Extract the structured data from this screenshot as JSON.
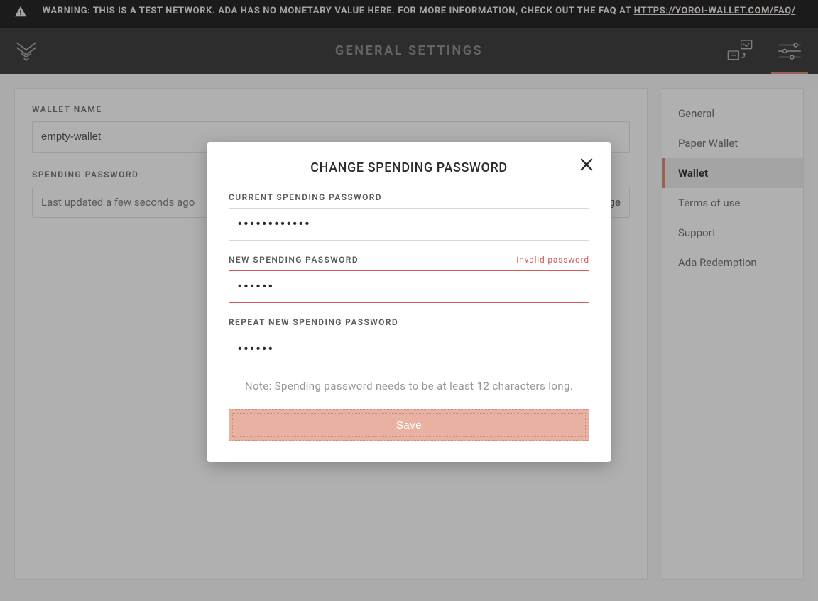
{
  "banner": {
    "text_prefix": "WARNING: THIS IS A TEST NETWORK. ADA HAS NO MONETARY VALUE HERE. FOR MORE INFORMATION, CHECK OUT THE FAQ AT ",
    "link_text": "HTTPS://YOROI-WALLET.COM/FAQ/"
  },
  "header": {
    "title": "GENERAL SETTINGS"
  },
  "settings": {
    "wallet_name_label": "WALLET NAME",
    "wallet_name_value": "empty-wallet",
    "spending_password_label": "SPENDING PASSWORD",
    "spending_password_status": "Last updated a few seconds ago",
    "spending_password_action": "change"
  },
  "sidebar": {
    "items": [
      {
        "label": "General",
        "active": false
      },
      {
        "label": "Paper Wallet",
        "active": false
      },
      {
        "label": "Wallet",
        "active": true
      },
      {
        "label": "Terms of use",
        "active": false
      },
      {
        "label": "Support",
        "active": false
      },
      {
        "label": "Ada Redemption",
        "active": false
      }
    ]
  },
  "modal": {
    "title": "CHANGE SPENDING PASSWORD",
    "current_label": "CURRENT SPENDING PASSWORD",
    "current_value": "••••••••••••",
    "new_label": "NEW SPENDING PASSWORD",
    "new_value": "••••••",
    "new_error": "Invalid password",
    "repeat_label": "REPEAT NEW SPENDING PASSWORD",
    "repeat_value": "••••••",
    "note": "Note: Spending password needs to be at least 12 characters long.",
    "save_label": "Save"
  },
  "colors": {
    "accent": "#d98771",
    "error": "#d65a5a"
  }
}
